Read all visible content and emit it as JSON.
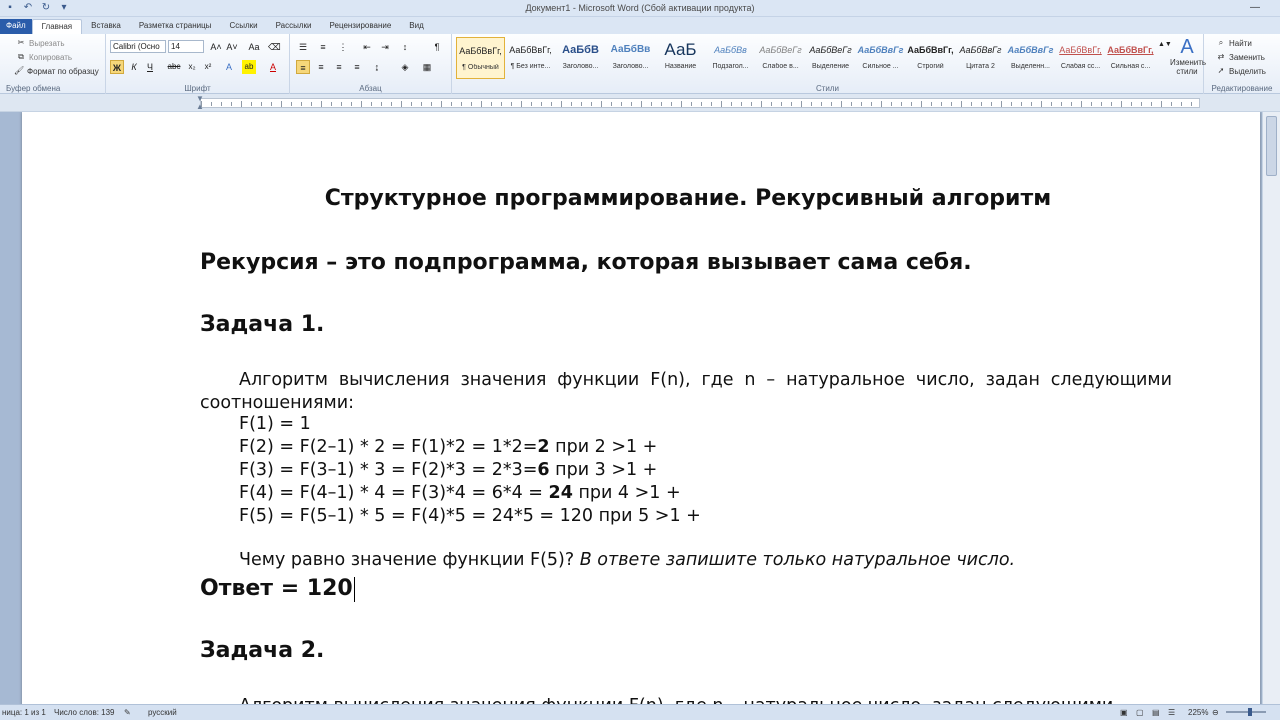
{
  "window": {
    "title": "Документ1  -  Microsoft Word (Сбой активации продукта)"
  },
  "tabs": [
    "Файл",
    "Главная",
    "Вставка",
    "Разметка страницы",
    "Ссылки",
    "Рассылки",
    "Рецензирование",
    "Вид"
  ],
  "active_tab": "Главная",
  "ribbon": {
    "clipboard": {
      "cut": "Вырезать",
      "copy": "Копировать",
      "format_painter": "Формат по образцу",
      "label": "Буфер обмена"
    },
    "font": {
      "font_name": "Calibri (Осно",
      "font_size": "14",
      "label": "Шрифт",
      "bold": "Ж",
      "italic": "К",
      "underline": "Ч",
      "strike": "abc"
    },
    "paragraph": {
      "label": "Абзац"
    },
    "styles": {
      "label": "Стили",
      "items": [
        {
          "sample": "АаБбВвГг,",
          "name": "¶ Обычный"
        },
        {
          "sample": "АаБбВвГг,",
          "name": "¶ Без инте..."
        },
        {
          "sample": "АаБбВ",
          "name": "Заголово..."
        },
        {
          "sample": "АаБбВв",
          "name": "Заголово..."
        },
        {
          "sample": "АаБ",
          "name": "Название"
        },
        {
          "sample": "АаБбВв",
          "name": "Подзагол..."
        },
        {
          "sample": "АаБбВеГг",
          "name": "Слабое в..."
        },
        {
          "sample": "АаБбВеГг",
          "name": "Выделение"
        },
        {
          "sample": "АаБбВвГг",
          "name": "Сильное ..."
        },
        {
          "sample": "АаБбВвГг,",
          "name": "Строгий"
        },
        {
          "sample": "АаБбВвГг",
          "name": "Цитата 2"
        },
        {
          "sample": "АаБбВвГг",
          "name": "Выделенн..."
        },
        {
          "sample": "АаБбВвГг,",
          "name": "Слабая сс..."
        },
        {
          "sample": "АаБбВвГг,",
          "name": "Сильная с..."
        }
      ],
      "change_styles": "Изменить стили"
    },
    "editing": {
      "find": "Найти",
      "replace": "Заменить",
      "select": "Выделить",
      "label": "Редактирование"
    }
  },
  "document": {
    "title": "Структурное программирование. Рекурсивный алгоритм",
    "definition": "Рекурсия – это подпрограмма, которая вызывает сама себя.",
    "task1": "Задача 1.",
    "para1": "Алгоритм вычисления значения функции F(n), где n – натуральное число, задан следующими соотношениями:",
    "lines": {
      "l1": "F(1) = 1",
      "l2a": "F(2) = F(2–1) * 2 = F(1)*2 = 1*2=",
      "l2b": "2",
      "l2c": " при 2 >1 +",
      "l3a": "F(3) = F(3–1) * 3 = F(2)*3 = 2*3=",
      "l3b": "6",
      "l3c": " при 3 >1 +",
      "l4a": "F(4) = F(4–1) * 4 = F(3)*4 = 6*4 = ",
      "l4b": "24",
      "l4c": " при 4 >1 +",
      "l5": "F(5) = F(5–1) * 5 = F(4)*5 = 24*5 = 120 при 5 >1 +"
    },
    "question": "Чему равно значение функции F(5)? ",
    "question_italic": "В ответе запишите только натуральное число.",
    "answer": "Ответ = 120",
    "task2": "Задача 2.",
    "para2_partial": "Алгоритм вычисления значения функции F(n), где n – натуральное число, задан следующими"
  },
  "status": {
    "page": "ница: 1 из 1",
    "words": "Число слов: 139",
    "language": "русский",
    "zoom": "225%"
  }
}
